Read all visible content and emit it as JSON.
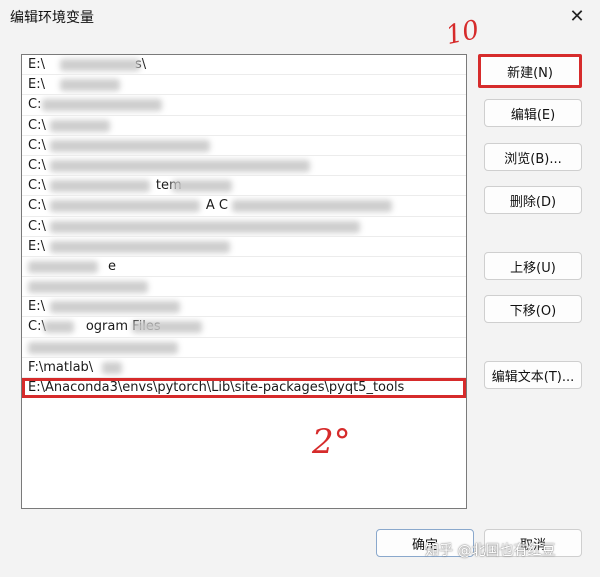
{
  "window": {
    "title": "编辑环境变量",
    "close_glyph": "✕"
  },
  "paths": [
    {
      "text": "E:\\",
      "tail": "s\\",
      "blur": [
        [
          38,
          80
        ]
      ]
    },
    {
      "text": "E:\\",
      "tail": "",
      "blur": [
        [
          38,
          60
        ]
      ]
    },
    {
      "text": "C:",
      "tail": "",
      "blur": [
        [
          20,
          120
        ]
      ]
    },
    {
      "text": "C:\\",
      "tail": "",
      "blur": [
        [
          28,
          60
        ]
      ]
    },
    {
      "text": "C:\\",
      "tail": "",
      "blur": [
        [
          28,
          160
        ]
      ]
    },
    {
      "text": "C:\\",
      "tail": "",
      "blur": [
        [
          28,
          260
        ]
      ]
    },
    {
      "text": "C:\\",
      "tail": "tem",
      "blur": [
        [
          28,
          100
        ],
        [
          150,
          60
        ]
      ]
    },
    {
      "text": "C:\\",
      "tail": "A C",
      "blur": [
        [
          28,
          150
        ],
        [
          210,
          160
        ]
      ]
    },
    {
      "text": "C:\\",
      "tail": "",
      "blur": [
        [
          28,
          310
        ]
      ]
    },
    {
      "text": "E:\\",
      "tail": "",
      "blur": [
        [
          28,
          180
        ]
      ]
    },
    {
      "text": "",
      "tail": "e",
      "blur": [
        [
          6,
          70
        ]
      ]
    },
    {
      "text": "",
      "tail": "",
      "blur": [
        [
          6,
          120
        ]
      ]
    },
    {
      "text": "E:\\",
      "tail": "",
      "blur": [
        [
          28,
          130
        ]
      ]
    },
    {
      "text": "C:\\",
      "tail": "ogram Files",
      "blur": [
        [
          22,
          30
        ],
        [
          110,
          70
        ]
      ]
    },
    {
      "text": "",
      "tail": "",
      "blur": [
        [
          6,
          150
        ]
      ]
    },
    {
      "text": "F:\\matlab\\",
      "tail": "",
      "blur": [
        [
          80,
          20
        ]
      ]
    },
    {
      "text": "E:\\Anaconda3\\envs\\pytorch\\Lib\\site-packages\\pyqt5_tools",
      "tail": "",
      "blur": [],
      "selected": true
    }
  ],
  "buttons": {
    "new": "新建(N)",
    "edit": "编辑(E)",
    "browse": "浏览(B)...",
    "delete": "删除(D)",
    "move_up": "上移(U)",
    "move_down": "下移(O)",
    "edit_text": "编辑文本(T)...",
    "ok": "确定",
    "cancel": "取消"
  },
  "annotations": {
    "step1": "10",
    "step2": "2°"
  },
  "watermark": "知乎 @北国也有红豆"
}
